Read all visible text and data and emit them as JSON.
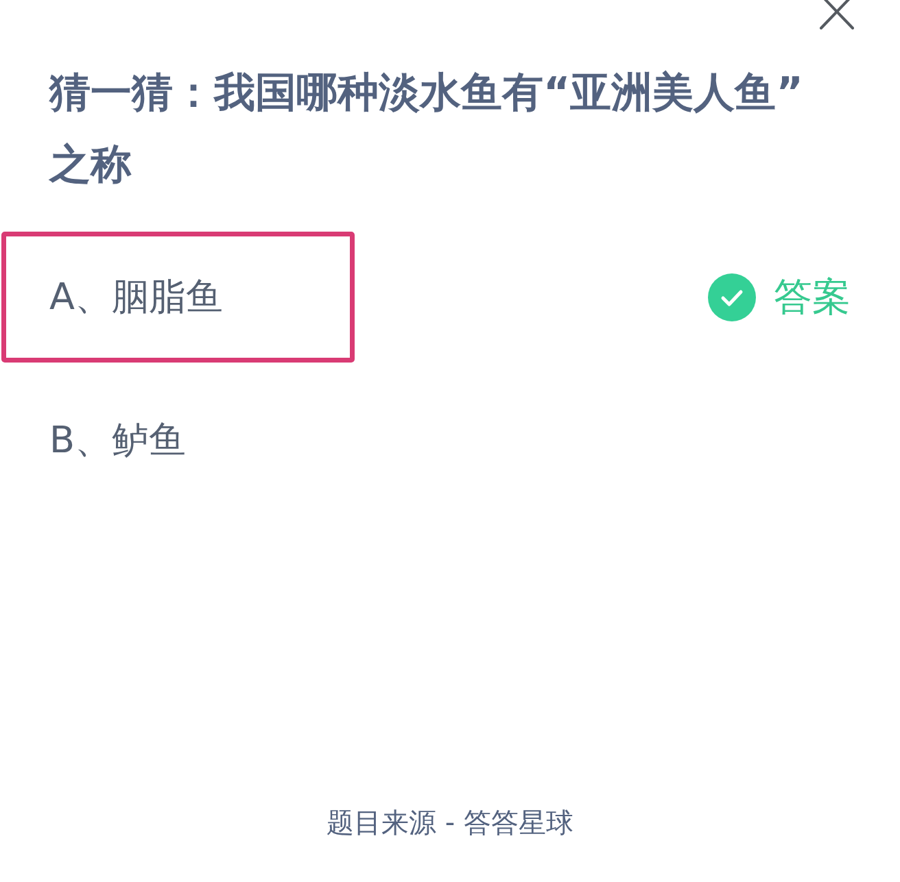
{
  "question": {
    "title": "猜一猜：我国哪种淡水鱼有“亚洲美人鱼”之称"
  },
  "options": [
    {
      "label": "A、胭脂鱼",
      "selected": true,
      "correct": true,
      "badge": "答案"
    },
    {
      "label": "B、鲈鱼",
      "selected": false,
      "correct": false
    }
  ],
  "footer": {
    "source": "题目来源 - 答答星球"
  }
}
